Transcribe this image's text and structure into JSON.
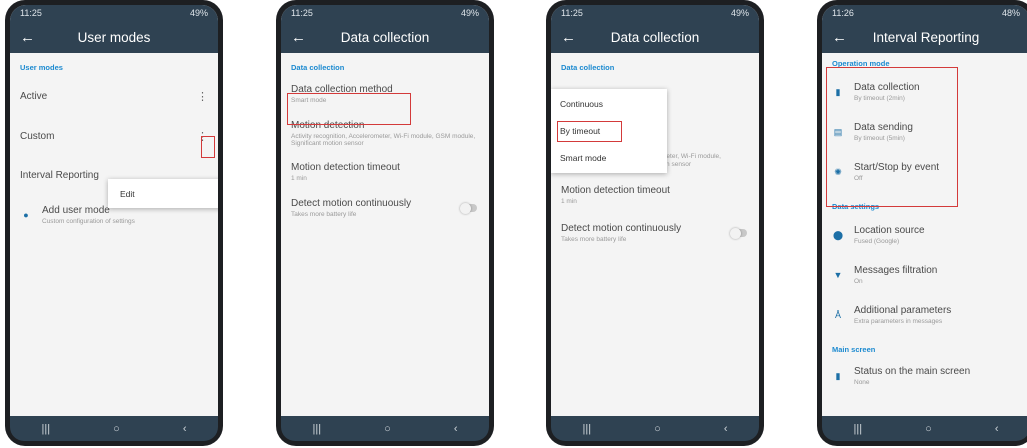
{
  "phone1": {
    "status_time": "11:25",
    "status_right": "49%",
    "title": "User modes",
    "section": "User modes",
    "items": [
      {
        "label": "Active"
      },
      {
        "label": "Custom"
      },
      {
        "label": "Interval Reporting"
      }
    ],
    "menu_edit": "Edit",
    "add": {
      "label": "Add user mode",
      "sub": "Custom configuration of settings"
    }
  },
  "phone2": {
    "status_time": "11:25",
    "status_right": "49%",
    "title": "Data collection",
    "section": "Data collection",
    "items": [
      {
        "label": "Data collection method",
        "sub": "Smart mode"
      },
      {
        "label": "Motion detection",
        "sub": "Activity recognition, Accelerometer, Wi-Fi module, GSM module, Significant motion sensor"
      },
      {
        "label": "Motion detection timeout",
        "sub": "1 min"
      },
      {
        "label": "Detect motion continuously",
        "sub": "Takes more battery life"
      }
    ]
  },
  "phone3": {
    "status_time": "11:25",
    "status_right": "49%",
    "title": "Data collection",
    "section": "Data collection",
    "options": [
      "Continuous",
      "By timeout",
      "Smart mode"
    ],
    "partial_sub": "meter, Wi-Fi module,",
    "partial_sub2": "ion sensor",
    "items": [
      {
        "label": "Motion detection timeout",
        "sub": "1 min"
      },
      {
        "label": "Detect motion continuously",
        "sub": "Takes more battery life"
      }
    ]
  },
  "phone4": {
    "status_time": "11:26",
    "status_right": "48%",
    "title": "Interval Reporting",
    "section1": "Operation mode",
    "op_items": [
      {
        "label": "Data collection",
        "sub": "By timeout (2min)"
      },
      {
        "label": "Data sending",
        "sub": "By timeout (5min)"
      },
      {
        "label": "Start/Stop by event",
        "sub": "Off"
      }
    ],
    "section2": "Data settings",
    "data_items": [
      {
        "label": "Location source",
        "sub": "Fused (Google)"
      },
      {
        "label": "Messages filtration",
        "sub": "On"
      },
      {
        "label": "Additional parameters",
        "sub": "Extra parameters in messages"
      }
    ],
    "section3": "Main screen",
    "main_items": [
      {
        "label": "Status on the main screen",
        "sub": "None"
      }
    ]
  },
  "nav": {
    "recent": "|||",
    "home": "○",
    "back": "‹"
  },
  "colors": {
    "appbar": "#2f4252",
    "accent": "#1c8ad0",
    "highlight": "#d33a3a"
  }
}
